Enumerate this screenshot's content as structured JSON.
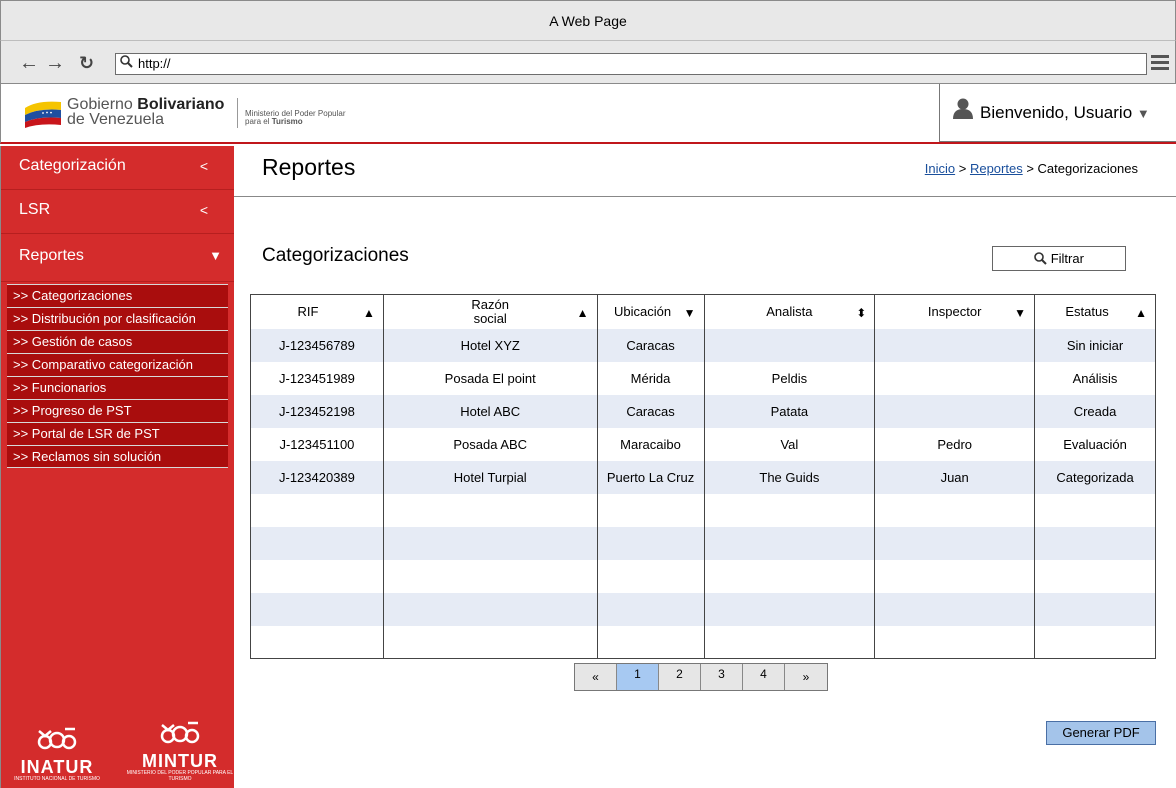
{
  "window": {
    "title": "A Web Page"
  },
  "browser": {
    "url": "http://"
  },
  "header": {
    "gov_prefix": "Gobierno ",
    "gov_bold": "Bolivariano",
    "gov_line2": "de Venezuela",
    "ministry_line1": "Ministerio del Poder Popular",
    "ministry_prefix": "para el ",
    "ministry_bold": "Turismo",
    "welcome": "Bienvenido, Usuario"
  },
  "sidebar": {
    "main": [
      {
        "label": "Categorización",
        "arrow": "<"
      },
      {
        "label": "LSR",
        "arrow": "<"
      },
      {
        "label": "Reportes",
        "arrow": "▼"
      }
    ],
    "sub": [
      ">> Categorizaciones",
      ">> Distribución por clasificación",
      ">> Gestión de casos",
      ">> Comparativo categorización",
      ">> Funcionarios",
      ">> Progreso de PST",
      ">> Portal de LSR de PST",
      ">> Reclamos sin solución"
    ],
    "brands": [
      {
        "name": "INATUR",
        "tagline": "INSTITUTO NACIONAL DE TURISMO"
      },
      {
        "name": "MINTUR",
        "tagline": "MINISTERIO DEL PODER POPULAR PARA EL TURISMO"
      }
    ]
  },
  "page": {
    "title": "Reportes",
    "breadcrumb": {
      "home": "Inicio",
      "reports": "Reportes",
      "current": "Categorizaciones",
      "sep": ">"
    },
    "section_title": "Categorizaciones",
    "filter_label": "Filtrar",
    "pdf_button": "Generar PDF"
  },
  "table": {
    "columns": [
      {
        "label": "RIF",
        "sort": "▲"
      },
      {
        "label": "Razón\nsocial",
        "sort": "▲"
      },
      {
        "label": "Ubicación",
        "sort": "▼"
      },
      {
        "label": "Analista",
        "sort": "⬍"
      },
      {
        "label": "Inspector",
        "sort": "▼"
      },
      {
        "label": "Estatus",
        "sort": "▲"
      }
    ],
    "rows": [
      [
        "J-123456789",
        "Hotel XYZ",
        "Caracas",
        "",
        "",
        "Sin iniciar"
      ],
      [
        "J-123451989",
        "Posada El point",
        "Mérida",
        "Peldis",
        "",
        "Análisis"
      ],
      [
        "J-123452198",
        "Hotel ABC",
        "Caracas",
        "Patata",
        "",
        "Creada"
      ],
      [
        "J-123451100",
        "Posada ABC",
        "Maracaibo",
        "Val",
        "Pedro",
        "Evaluación"
      ],
      [
        "J-123420389",
        "Hotel Turpial",
        "Puerto La Cruz",
        "The Guids",
        "Juan",
        "Categorizada"
      ],
      [
        "",
        "",
        "",
        "",
        "",
        ""
      ],
      [
        "",
        "",
        "",
        "",
        "",
        ""
      ],
      [
        "",
        "",
        "",
        "",
        "",
        ""
      ],
      [
        "",
        "",
        "",
        "",
        "",
        ""
      ],
      [
        "",
        "",
        "",
        "",
        "",
        ""
      ]
    ]
  },
  "pagination": {
    "prev": "«",
    "pages": [
      "1",
      "2",
      "3",
      "4"
    ],
    "next": "»",
    "current": "1"
  },
  "colors": {
    "sidebar": "#d42c2c",
    "submenu": "#a90d0d",
    "row_alt": "#e6ebf5",
    "active_page": "#a7c9f2",
    "header_line": "#c0161b"
  }
}
